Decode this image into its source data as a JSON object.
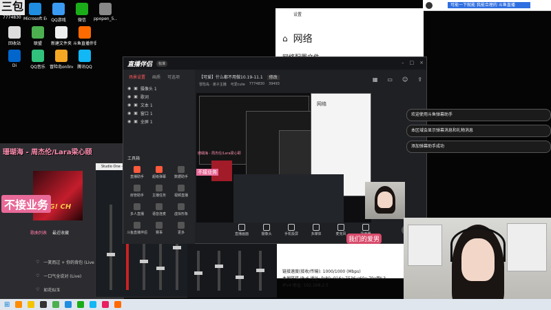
{
  "corner": {
    "badge": "三包",
    "uid": "7774830"
  },
  "desktop": {
    "icons": [
      {
        "label": "Microsoft Edge",
        "color": "#1f8de0"
      },
      {
        "label": "QQ游戏",
        "color": "#3b9bf3"
      },
      {
        "label": "微信",
        "color": "#1aad19"
      },
      {
        "label": "ppopen_5...",
        "color": "#888888"
      },
      {
        "label": "回收站",
        "color": "#dddddd"
      },
      {
        "label": "联盟",
        "color": "#4caf50"
      },
      {
        "label": "新建文件夹",
        "color": "#eeeeee"
      },
      {
        "label": "斗鱼直播伴侣",
        "color": "#ff6a00"
      },
      {
        "label": "Di",
        "color": "#0066cc"
      },
      {
        "label": "QQ音乐",
        "color": "#31c27c"
      },
      {
        "label": "冒险岛online",
        "color": "#f5a623"
      },
      {
        "label": "腾讯QQ",
        "color": "#12b7f5"
      }
    ]
  },
  "settings": {
    "title": "设置",
    "heading": "网络",
    "subheading": "网络配置文件",
    "rows": [
      "链接速度(接收/传输):   1000/1000 (Mbps)",
      "本地链接 IPv6 地址:   fe80::916a:7536:c60e:79eff%3",
      "IPv4 地址:   192.168.2.5"
    ]
  },
  "live_header": {
    "link_text": "可能一下就能 我能合理的 斗鱼直播"
  },
  "stream_overlay": {
    "song_title": "珊瑚海 - 周杰伦/Lara梁心颐",
    "no_business": "不接业务",
    "album_text": "SING! CH",
    "tabs": [
      "歌曲列表",
      "最近收藏"
    ],
    "playlist": [
      "一笑而过 + 你的背包 (Live",
      "一口气全说对 (Live)",
      "如花似玉"
    ]
  },
  "mixer": {
    "title": "Studio One - 混音"
  },
  "app": {
    "logo": "直播伴侣",
    "badge": "标准",
    "tabs": [
      "场景设置",
      "画质",
      "可选项"
    ],
    "scenes": [
      "摄像头 1",
      "歌词",
      "文本 1",
      "窗口 1",
      "全屏 1"
    ],
    "tools_title": "工具箱",
    "tools": [
      "直播助手",
      "超级弹幕",
      "数据助手",
      "房管助手",
      "主播任务",
      "视频直播",
      "多人直播",
      "语音连麦",
      "虚拟形象",
      "斗鱼直播伴侣",
      "赛事",
      "更多"
    ],
    "stream_title": "【可爱】什么都不用做10.19-11.1",
    "title_tag": "修改",
    "info": [
      "冒险岛 · 弟子主播",
      "可爱cute",
      "7774830",
      "39493"
    ],
    "bottom_tools": [
      "直播画面",
      "摄像头",
      "手机投屏",
      "多媒体",
      "麦克风",
      "扬声器"
    ],
    "go_live": "开播"
  },
  "chat": [
    "欢迎使用斗鱼弹幕助手",
    "本区域会显示弹幕消息和礼物消息",
    "添加弹幕助手成功"
  ],
  "love_text": "我们的爱男",
  "nested_labels": {
    "net": "网络",
    "overlay_title": "珊瑚海 - 周杰伦/Lara梁心颐",
    "overlay_tag": "不接业务"
  }
}
